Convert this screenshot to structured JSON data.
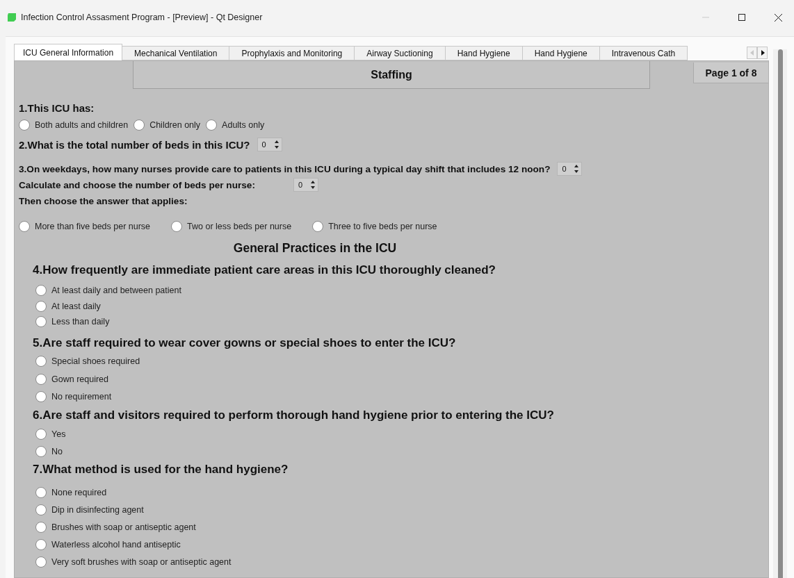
{
  "window": {
    "title": "Infection Control Assasment Program - [Preview] - Qt Designer"
  },
  "tabs": [
    {
      "label": "ICU General Information",
      "selected": true
    },
    {
      "label": "Mechanical Ventilation",
      "selected": false
    },
    {
      "label": "Prophylaxis and Monitoring",
      "selected": false
    },
    {
      "label": "Airway Suctioning",
      "selected": false
    },
    {
      "label": "Hand Hygiene",
      "selected": false
    },
    {
      "label": "Hand Hygiene",
      "selected": false
    },
    {
      "label": "Intravenous Cath",
      "selected": false
    }
  ],
  "tab_scroll": {
    "left_disabled": true,
    "right_disabled": false
  },
  "staffing": {
    "title": "Staffing",
    "page_label": "Page 1 of 8",
    "blocks": [
      {
        "kind": "heading",
        "text": "1.This ICU has:"
      },
      {
        "kind": "radios",
        "options": [
          {
            "label": "Both adults and children",
            "selected": false
          },
          {
            "label": "Children only",
            "selected": false
          },
          {
            "label": "Adults only",
            "selected": false
          }
        ]
      },
      {
        "kind": "spin",
        "text": "2.What is the total number of beds in this ICU?",
        "value": "0"
      },
      {
        "kind": "spin",
        "text": "3.On weekdays, how many nurses provide care to patients in this ICU during a typical day shift that includes 12 noon?",
        "value": "0"
      },
      {
        "kind": "spin",
        "text": "Calculate and choose the number of beds per nurse:",
        "value": "0"
      },
      {
        "kind": "note",
        "text": "Then choose the answer that applies:"
      },
      {
        "kind": "radios",
        "options": [
          {
            "label": "More than five beds per nurse",
            "selected": false
          },
          {
            "label": "Two or less beds per nurse",
            "selected": false
          },
          {
            "label": "Three to five beds per nurse",
            "selected": false
          }
        ]
      }
    ]
  },
  "general_practices": {
    "title": "General Practices in the ICU",
    "questions": [
      {
        "text": "4.How frequently are immediate patient care areas in this ICU thoroughly cleaned?",
        "options": [
          {
            "label": "At least daily and between patient",
            "selected": false
          },
          {
            "label": "At least daily",
            "selected": false
          },
          {
            "label": "Less than daily",
            "selected": false
          }
        ]
      },
      {
        "text": "5.Are staff required to wear cover gowns or special shoes to enter the ICU?",
        "options": [
          {
            "label": "Special shoes required",
            "selected": false
          },
          {
            "label": "Gown required",
            "selected": false
          },
          {
            "label": "No requirement",
            "selected": false
          }
        ]
      },
      {
        "text": "6.Are staff and visitors required to perform thorough hand hygiene prior to entering the ICU?",
        "options": [
          {
            "label": "Yes",
            "selected": false
          },
          {
            "label": "No",
            "selected": false
          }
        ]
      },
      {
        "text": "7.What method is used for the hand hygiene?",
        "options": [
          {
            "label": "None required",
            "selected": false
          },
          {
            "label": "Dip in disinfecting agent",
            "selected": false
          },
          {
            "label": "Brushes with soap or antiseptic agent",
            "selected": false
          },
          {
            "label": "Waterless alcohol hand antiseptic",
            "selected": false
          },
          {
            "label": "Very soft brushes with soap or antiseptic agent",
            "selected": false
          }
        ]
      }
    ]
  }
}
